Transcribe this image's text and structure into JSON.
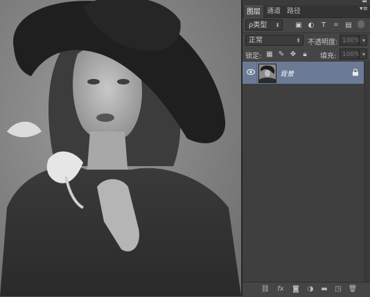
{
  "tabs": [
    {
      "label": "图层",
      "active": true
    },
    {
      "label": "通道",
      "active": false
    },
    {
      "label": "路径",
      "active": false
    }
  ],
  "filter": {
    "label": "ρ类型"
  },
  "blend": {
    "mode": "正常",
    "opacity_label": "不透明度:",
    "opacity_value": "100%"
  },
  "lock": {
    "label": "锁定:",
    "fill_label": "填充:",
    "fill_value": "100%"
  },
  "layers": [
    {
      "name": "背景",
      "visible": true,
      "locked": true,
      "selected": true
    }
  ],
  "icons": {
    "collapse": "double-chevron-icon",
    "panel_menu": "panel-menu-icon",
    "bottom": [
      "link-icon",
      "fx-icon",
      "mask-icon",
      "adjustment-icon",
      "folder-icon",
      "new-layer-icon",
      "trash-icon"
    ]
  },
  "colors": {
    "selected_layer": "#6b7b96",
    "panel_bg": "#454545"
  }
}
